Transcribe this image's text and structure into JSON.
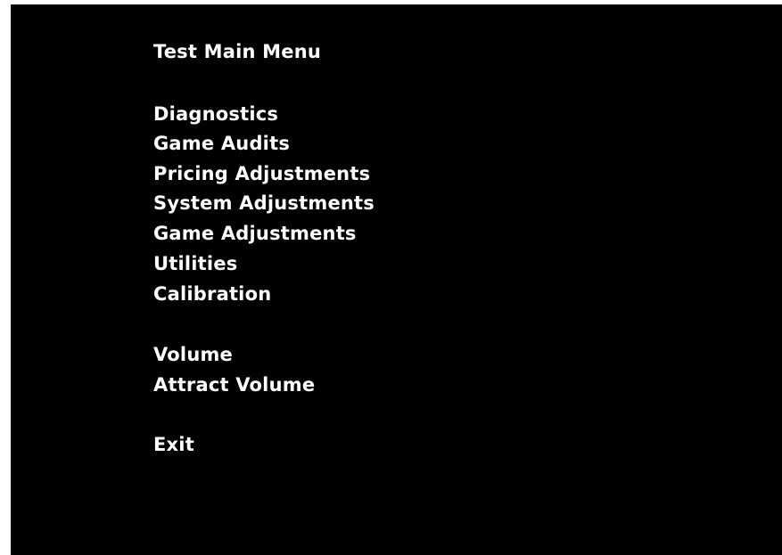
{
  "menu": {
    "title": "Test Main Menu",
    "group1": [
      "Diagnostics",
      "Game Audits",
      "Pricing Adjustments",
      "System Adjustments",
      "Game Adjustments",
      "Utilities",
      "Calibration"
    ],
    "group2": [
      "Volume",
      "Attract Volume"
    ],
    "group3": [
      "Exit"
    ]
  },
  "colors": {
    "background": "#000000",
    "text": "#ffffff"
  }
}
